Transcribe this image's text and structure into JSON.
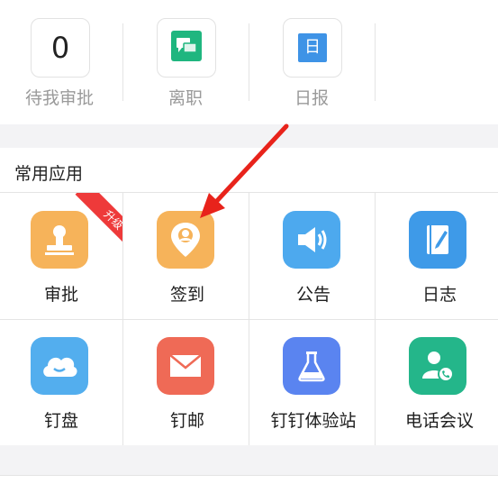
{
  "quick_stats": [
    {
      "value": "0",
      "label": "待我审批"
    },
    {
      "icon": "chat-icon",
      "label": "离职"
    },
    {
      "icon": "calendar-day-icon",
      "icon_text": "日",
      "label": "日报"
    }
  ],
  "section": {
    "title": "常用应用",
    "apps": [
      {
        "label": "审批",
        "icon": "stamp-icon",
        "color": "#f6b35a",
        "badge": "升级"
      },
      {
        "label": "签到",
        "icon": "location-pin-icon",
        "color": "#f6b35a"
      },
      {
        "label": "公告",
        "icon": "megaphone-icon",
        "color": "#4da9ee"
      },
      {
        "label": "日志",
        "icon": "notebook-pen-icon",
        "color": "#3e9ae8"
      },
      {
        "label": "钉盘",
        "icon": "cloud-icon",
        "color": "#53aeee"
      },
      {
        "label": "钉邮",
        "icon": "mail-icon",
        "color": "#ef6a56"
      },
      {
        "label": "钉钉体验站",
        "icon": "flask-icon",
        "color": "#5a84f0"
      },
      {
        "label": "电话会议",
        "icon": "phone-user-icon",
        "color": "#24b68a"
      }
    ]
  },
  "colors": {
    "annotation_arrow": "#e8231b",
    "ribbon": "#ee3a3a"
  }
}
